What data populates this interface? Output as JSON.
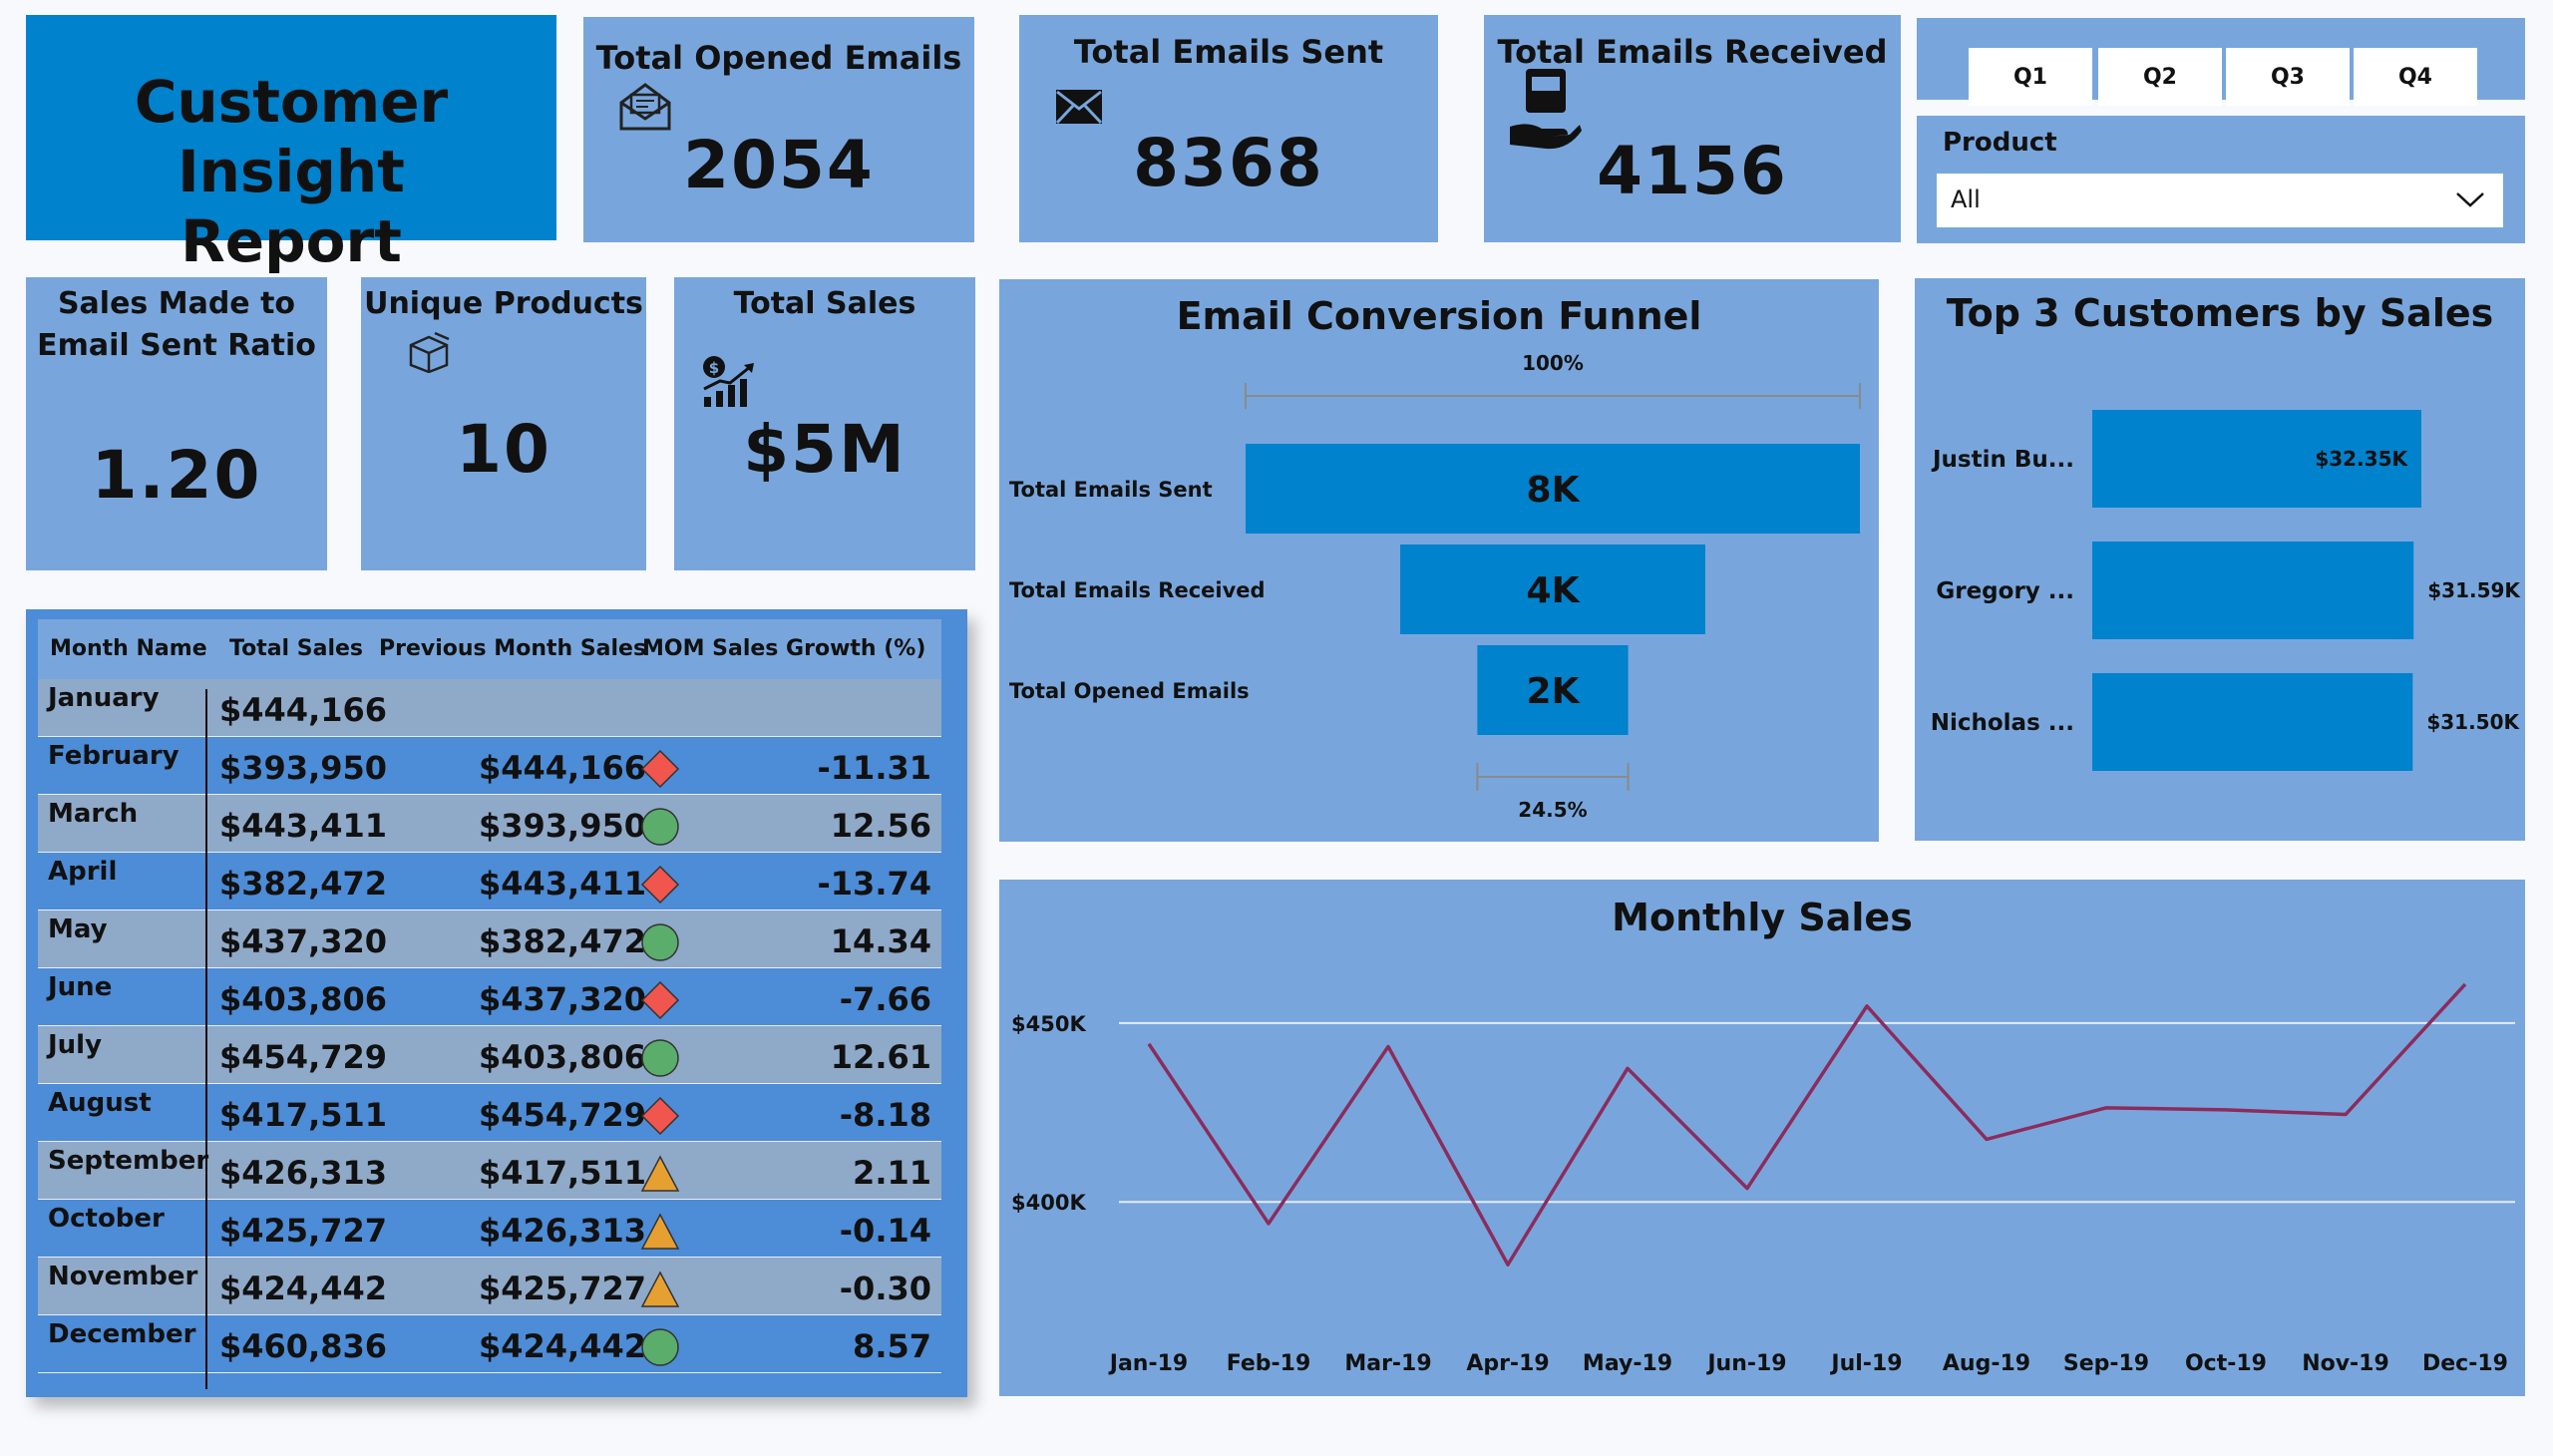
{
  "report": {
    "title_line1": "Customer Insight",
    "title_line2": "Report"
  },
  "kpis": {
    "opened": {
      "label": "Total Opened Emails",
      "value": "2054",
      "icon": "envelope-open-icon"
    },
    "sent": {
      "label": "Total Emails Sent",
      "value": "8368",
      "icon": "envelope-icon"
    },
    "received": {
      "label": "Total Emails Received",
      "value": "4156",
      "icon": "inbox-hand-icon"
    },
    "ratio": {
      "label_line1": "Sales Made to",
      "label_line2": "Email Sent Ratio",
      "value": "1.20"
    },
    "unique": {
      "label": "Unique Products",
      "value": "10",
      "icon": "box-icon"
    },
    "sales": {
      "label": "Total Sales",
      "value": "$5M",
      "icon": "sales-growth-icon"
    }
  },
  "filters": {
    "quarters": [
      "Q1",
      "Q2",
      "Q3",
      "Q4"
    ],
    "product_label": "Product",
    "product_selected": "All"
  },
  "table": {
    "headers": [
      "Month Name",
      "Total Sales",
      "Previous Month Sales",
      "MOM Sales Growth (%)"
    ],
    "rows": [
      {
        "month": "January",
        "total": "$444,166",
        "prev": "",
        "growth": "",
        "indicator": "none"
      },
      {
        "month": "February",
        "total": "$393,950",
        "prev": "$444,166",
        "growth": "-11.31",
        "indicator": "red-diamond"
      },
      {
        "month": "March",
        "total": "$443,411",
        "prev": "$393,950",
        "growth": "12.56",
        "indicator": "green-circle"
      },
      {
        "month": "April",
        "total": "$382,472",
        "prev": "$443,411",
        "growth": "-13.74",
        "indicator": "red-diamond"
      },
      {
        "month": "May",
        "total": "$437,320",
        "prev": "$382,472",
        "growth": "14.34",
        "indicator": "green-circle"
      },
      {
        "month": "June",
        "total": "$403,806",
        "prev": "$437,320",
        "growth": "-7.66",
        "indicator": "red-diamond"
      },
      {
        "month": "July",
        "total": "$454,729",
        "prev": "$403,806",
        "growth": "12.61",
        "indicator": "green-circle"
      },
      {
        "month": "August",
        "total": "$417,511",
        "prev": "$454,729",
        "growth": "-8.18",
        "indicator": "red-diamond"
      },
      {
        "month": "September",
        "total": "$426,313",
        "prev": "$417,511",
        "growth": "2.11",
        "indicator": "orange-triangle"
      },
      {
        "month": "October",
        "total": "$425,727",
        "prev": "$426,313",
        "growth": "-0.14",
        "indicator": "orange-triangle"
      },
      {
        "month": "November",
        "total": "$424,442",
        "prev": "$425,727",
        "growth": "-0.30",
        "indicator": "orange-triangle"
      },
      {
        "month": "December",
        "total": "$460,836",
        "prev": "$424,442",
        "growth": "8.57",
        "indicator": "green-circle"
      }
    ]
  },
  "colors": {
    "card": "#78a6dc",
    "bar": "#0082cd",
    "line": "#8b2c5c",
    "title_card": "#0082cd",
    "red": "#f0564e",
    "green": "#5aad6a",
    "orange": "#e6a032"
  },
  "chart_data": [
    {
      "type": "funnel",
      "title": "Email Conversion Funnel",
      "categories": [
        "Total Emails Sent",
        "Total Emails Received",
        "Total Opened Emails"
      ],
      "values": [
        8368,
        4156,
        2054
      ],
      "data_labels": [
        "8K",
        "4K",
        "2K"
      ],
      "top_pct_label": "100%",
      "bottom_pct_label": "24.5%"
    },
    {
      "type": "bar",
      "orientation": "horizontal",
      "title": "Top 3 Customers by Sales",
      "categories": [
        "Justin Bu...",
        "Gregory ...",
        "Nicholas ..."
      ],
      "values": [
        32350,
        31590,
        31500
      ],
      "data_labels": [
        "$32.35K",
        "$31.59K",
        "$31.50K"
      ]
    },
    {
      "type": "line",
      "title": "Monthly Sales",
      "x": [
        "Jan-19",
        "Feb-19",
        "Mar-19",
        "Apr-19",
        "May-19",
        "Jun-19",
        "Jul-19",
        "Aug-19",
        "Sep-19",
        "Oct-19",
        "Nov-19",
        "Dec-19"
      ],
      "values": [
        444166,
        393950,
        443411,
        382472,
        437320,
        403806,
        454729,
        417511,
        426313,
        425727,
        424442,
        460836
      ],
      "yticks": [
        400000,
        450000
      ],
      "ytick_labels": [
        "$400K",
        "$450K"
      ],
      "ylim": [
        380000,
        465000
      ],
      "grid": true
    }
  ]
}
